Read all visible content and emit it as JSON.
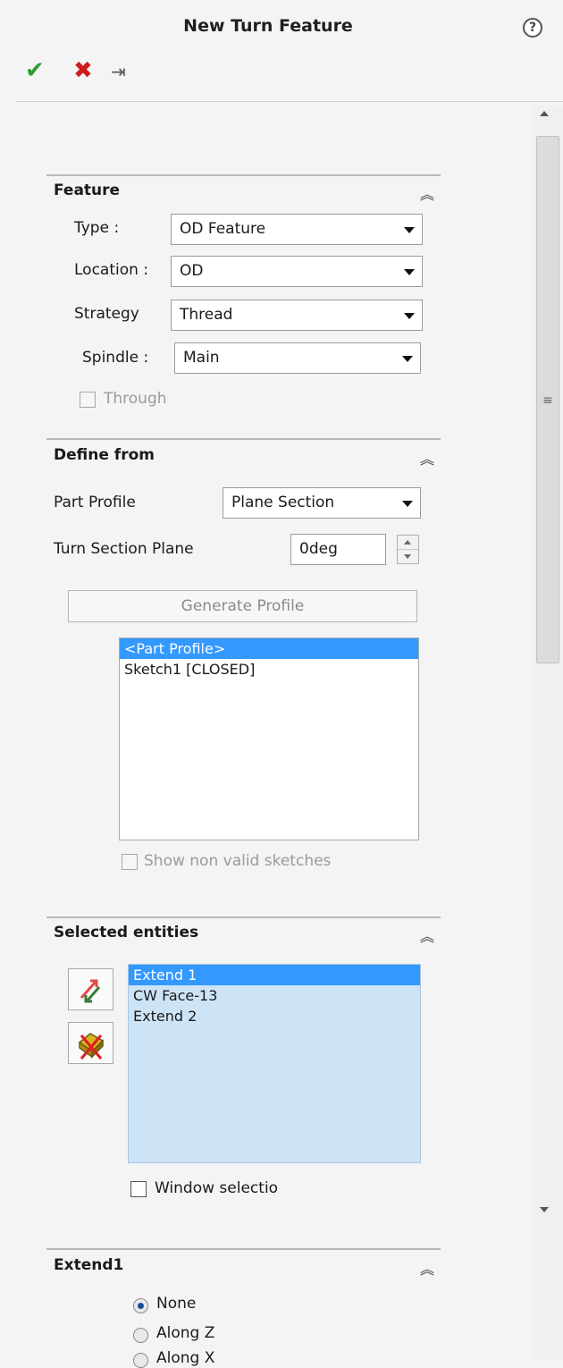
{
  "header": {
    "title": "New Turn Feature",
    "help_icon": "help-icon"
  },
  "toolbar": {
    "ok_icon": "checkmark-icon",
    "cancel_icon": "close-icon",
    "pin_icon": "pushpin-icon"
  },
  "feature": {
    "title": "Feature",
    "type": {
      "label": "Type :",
      "value": "OD Feature"
    },
    "location": {
      "label": "Location :",
      "value": "OD"
    },
    "strategy": {
      "label": "Strategy",
      "value": "Thread"
    },
    "spindle": {
      "label": "Spindle :",
      "value": "Main"
    },
    "through": {
      "label": "Through",
      "checked": false,
      "enabled": false
    }
  },
  "define_from": {
    "title": "Define from",
    "part_profile": {
      "label": "Part Profile",
      "value": "Plane Section"
    },
    "turn_section_plane": {
      "label": "Turn Section Plane",
      "value": "0deg"
    },
    "generate_button": "Generate Profile",
    "profiles": [
      "<Part Profile>",
      "Sketch1 [CLOSED]"
    ],
    "selected_profile_index": 0,
    "show_non_valid": {
      "label": "Show non valid sketches",
      "checked": false
    }
  },
  "selected_entities": {
    "title": "Selected entities",
    "items": [
      "Extend 1",
      "CW Face-13",
      "Extend 2"
    ],
    "selected_index": 0,
    "reverse_icon": "reverse-direction-icon",
    "clear_icon": "clear-selection-icon",
    "window_selection": {
      "label": "Window selectio",
      "checked": false
    }
  },
  "extend1": {
    "title": "Extend1",
    "options": [
      "None",
      "Along Z",
      "Along X"
    ],
    "selected": "None"
  },
  "colors": {
    "selection": "#3399ff",
    "ok": "#2e9e2e",
    "cancel": "#d01c1c",
    "entity_list_bg": "#cde4f7"
  }
}
